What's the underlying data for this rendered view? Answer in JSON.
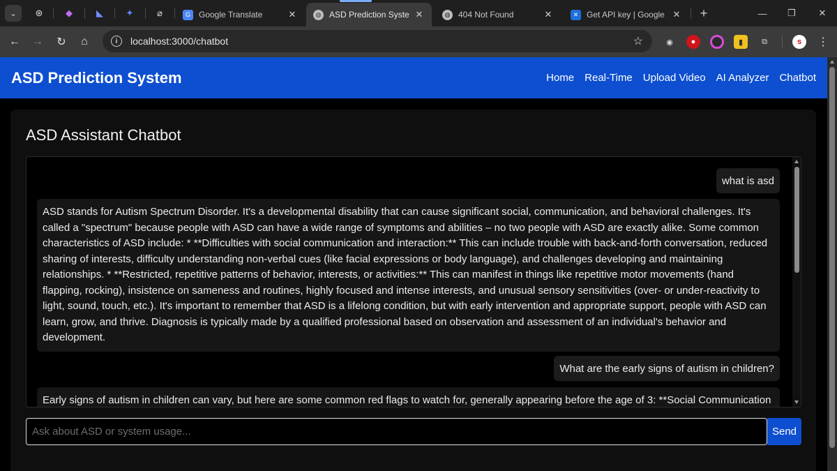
{
  "browser": {
    "tabs": [
      {
        "title": "Google Translate",
        "active": false
      },
      {
        "title": "ASD Prediction System",
        "active": true
      },
      {
        "title": "404 Not Found",
        "active": false
      },
      {
        "title": "Get API key | Google AI",
        "active": false
      }
    ],
    "url": "localhost:3000/chatbot"
  },
  "navbar": {
    "brand": "ASD Prediction System",
    "links": [
      "Home",
      "Real-Time",
      "Upload Video",
      "AI Analyzer",
      "Chatbot"
    ]
  },
  "chat": {
    "title": "ASD Assistant Chatbot",
    "messages": [
      {
        "role": "user",
        "text": "what is asd"
      },
      {
        "role": "bot",
        "text": "ASD stands for Autism Spectrum Disorder. It's a developmental disability that can cause significant social, communication, and behavioral challenges. It's called a \"spectrum\" because people with ASD can have a wide range of symptoms and abilities – no two people with ASD are exactly alike. Some common characteristics of ASD include: * **Difficulties with social communication and interaction:** This can include trouble with back-and-forth conversation, reduced sharing of interests, difficulty understanding non-verbal cues (like facial expressions or body language), and challenges developing and maintaining relationships. * **Restricted, repetitive patterns of behavior, interests, or activities:** This can manifest in things like repetitive motor movements (hand flapping, rocking), insistence on sameness and routines, highly focused and intense interests, and unusual sensory sensitivities (over- or under-reactivity to light, sound, touch, etc.). It's important to remember that ASD is a lifelong condition, but with early intervention and appropriate support, people with ASD can learn, grow, and thrive. Diagnosis is typically made by a qualified professional based on observation and assessment of an individual's behavior and development."
      },
      {
        "role": "user",
        "text": "What are the early signs of autism in children?"
      },
      {
        "role": "bot",
        "text": "Early signs of autism in children can vary, but here are some common red flags to watch for, generally appearing before the age of 3: **Social Communication"
      }
    ],
    "input_placeholder": "Ask about ASD or system usage...",
    "send_label": "Send"
  },
  "colors": {
    "navbar": "#0d4fd0",
    "card": "#0f0f0f",
    "bubble": "#161616"
  }
}
